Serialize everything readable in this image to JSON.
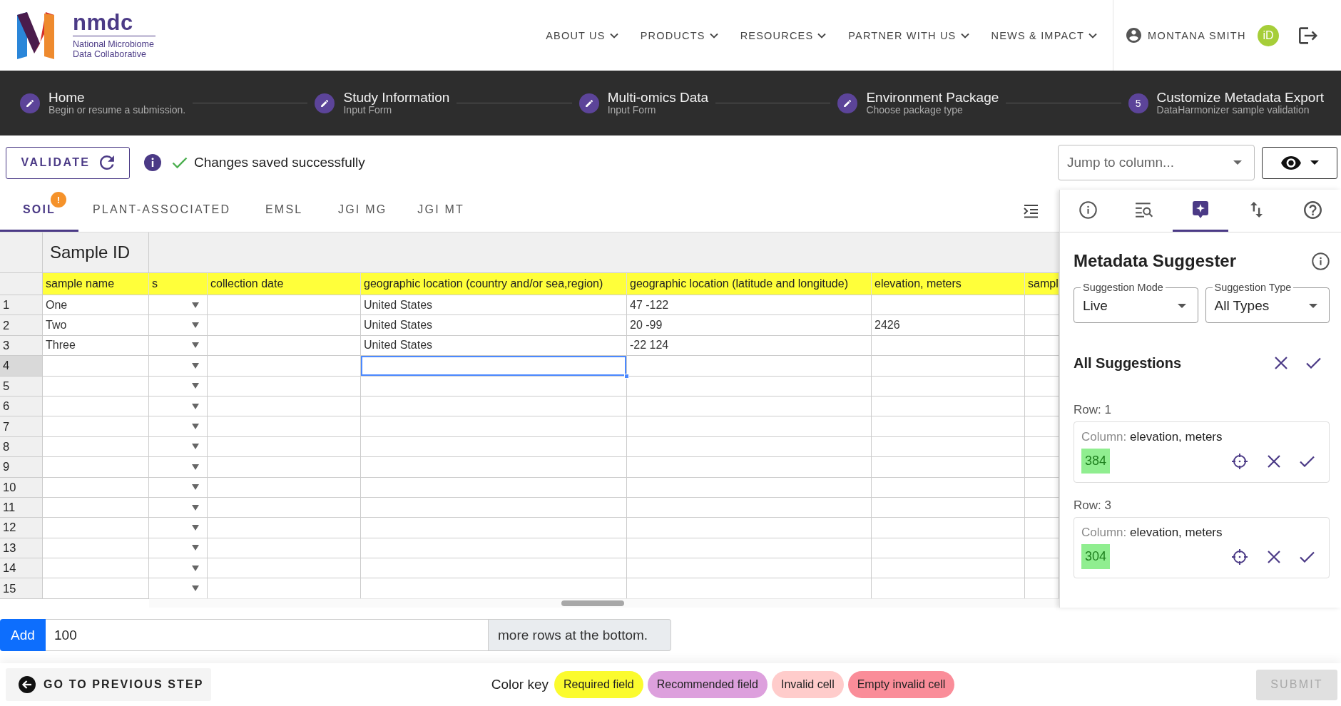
{
  "header": {
    "logo": {
      "name": "nmdc",
      "tagline": [
        "National Microbiome",
        "Data Collaborative"
      ]
    },
    "nav": [
      {
        "label": "ABOUT US"
      },
      {
        "label": "PRODUCTS"
      },
      {
        "label": "RESOURCES"
      },
      {
        "label": "PARTNER WITH US"
      },
      {
        "label": "NEWS & IMPACT"
      }
    ],
    "user": {
      "name": "MONTANA SMITH",
      "badge": "iD"
    }
  },
  "steps": [
    {
      "title": "Home",
      "subtitle": "Begin or resume a submission.",
      "complete": true
    },
    {
      "title": "Study Information",
      "subtitle": "Input Form",
      "complete": true
    },
    {
      "title": "Multi-omics Data",
      "subtitle": "Input Form",
      "complete": true
    },
    {
      "title": "Environment Package",
      "subtitle": "Choose package type",
      "complete": true
    },
    {
      "title": "Customize Metadata Export",
      "subtitle": "DataHarmonizer sample validation",
      "complete": false,
      "number": "5"
    }
  ],
  "toolbar": {
    "validate": "VALIDATE",
    "status": "Changes saved successfully",
    "jump": {
      "placeholder": "Jump to column..."
    }
  },
  "tabs": [
    {
      "label": "SOIL",
      "selected": true,
      "badge": "!"
    },
    {
      "label": "PLANT-ASSOCIATED",
      "selected": false
    },
    {
      "label": "EMSL",
      "selected": false
    },
    {
      "label": "JGI MG",
      "selected": false
    },
    {
      "label": "JGI MT",
      "selected": false
    }
  ],
  "table": {
    "group_header": "Sample ID",
    "columns": [
      {
        "label": "sample name",
        "kind": "text"
      },
      {
        "label": "s",
        "kind": "dropdown"
      },
      {
        "label": "collection date",
        "kind": "text"
      },
      {
        "label": "geographic location (country and/or sea,region)",
        "kind": "text"
      },
      {
        "label": "geographic location (latitude and longitude)",
        "kind": "text"
      },
      {
        "label": "elevation, meters",
        "kind": "text"
      },
      {
        "label": "sampl",
        "kind": "text"
      }
    ],
    "rows": [
      {
        "number": "1",
        "selected": false,
        "cells": [
          {
            "text": "One",
            "selected": false
          },
          {
            "selected": false
          },
          {
            "selected": false
          },
          {
            "text": "United States",
            "selected": false
          },
          {
            "text": "47 -122",
            "selected": false
          },
          {
            "selected": false
          },
          {
            "selected": false
          }
        ]
      },
      {
        "number": "2",
        "selected": false,
        "cells": [
          {
            "text": "Two",
            "selected": false
          },
          {
            "selected": false
          },
          {
            "selected": false
          },
          {
            "text": "United States",
            "selected": false
          },
          {
            "text": "20 -99",
            "selected": false
          },
          {
            "text": "2426",
            "selected": false
          },
          {
            "selected": false
          }
        ]
      },
      {
        "number": "3",
        "selected": false,
        "cells": [
          {
            "text": "Three",
            "selected": false
          },
          {
            "selected": false
          },
          {
            "selected": false
          },
          {
            "text": "United States",
            "selected": false
          },
          {
            "text": "-22 124",
            "selected": false
          },
          {
            "selected": false
          },
          {
            "selected": false
          }
        ]
      },
      {
        "number": "4",
        "selected": true,
        "cells": [
          {
            "selected": false
          },
          {
            "selected": false
          },
          {
            "selected": false
          },
          {
            "selected": true
          },
          {
            "selected": false
          },
          {
            "selected": false
          },
          {
            "selected": false
          }
        ]
      },
      {
        "number": "5",
        "selected": false,
        "cells": [
          {
            "selected": false
          },
          {
            "selected": false
          },
          {
            "selected": false
          },
          {
            "selected": false
          },
          {
            "selected": false
          },
          {
            "selected": false
          },
          {
            "selected": false
          }
        ]
      },
      {
        "number": "6",
        "selected": false,
        "cells": [
          {
            "selected": false
          },
          {
            "selected": false
          },
          {
            "selected": false
          },
          {
            "selected": false
          },
          {
            "selected": false
          },
          {
            "selected": false
          },
          {
            "selected": false
          }
        ]
      },
      {
        "number": "7",
        "selected": false,
        "cells": [
          {
            "selected": false
          },
          {
            "selected": false
          },
          {
            "selected": false
          },
          {
            "selected": false
          },
          {
            "selected": false
          },
          {
            "selected": false
          },
          {
            "selected": false
          }
        ]
      },
      {
        "number": "8",
        "selected": false,
        "cells": [
          {
            "selected": false
          },
          {
            "selected": false
          },
          {
            "selected": false
          },
          {
            "selected": false
          },
          {
            "selected": false
          },
          {
            "selected": false
          },
          {
            "selected": false
          }
        ]
      },
      {
        "number": "9",
        "selected": false,
        "cells": [
          {
            "selected": false
          },
          {
            "selected": false
          },
          {
            "selected": false
          },
          {
            "selected": false
          },
          {
            "selected": false
          },
          {
            "selected": false
          },
          {
            "selected": false
          }
        ]
      },
      {
        "number": "10",
        "selected": false,
        "cells": [
          {
            "selected": false
          },
          {
            "selected": false
          },
          {
            "selected": false
          },
          {
            "selected": false
          },
          {
            "selected": false
          },
          {
            "selected": false
          },
          {
            "selected": false
          }
        ]
      },
      {
        "number": "11",
        "selected": false,
        "cells": [
          {
            "selected": false
          },
          {
            "selected": false
          },
          {
            "selected": false
          },
          {
            "selected": false
          },
          {
            "selected": false
          },
          {
            "selected": false
          },
          {
            "selected": false
          }
        ]
      },
      {
        "number": "12",
        "selected": false,
        "cells": [
          {
            "selected": false
          },
          {
            "selected": false
          },
          {
            "selected": false
          },
          {
            "selected": false
          },
          {
            "selected": false
          },
          {
            "selected": false
          },
          {
            "selected": false
          }
        ]
      },
      {
        "number": "13",
        "selected": false,
        "cells": [
          {
            "selected": false
          },
          {
            "selected": false
          },
          {
            "selected": false
          },
          {
            "selected": false
          },
          {
            "selected": false
          },
          {
            "selected": false
          },
          {
            "selected": false
          }
        ]
      },
      {
        "number": "14",
        "selected": false,
        "cells": [
          {
            "selected": false
          },
          {
            "selected": false
          },
          {
            "selected": false
          },
          {
            "selected": false
          },
          {
            "selected": false
          },
          {
            "selected": false
          },
          {
            "selected": false
          }
        ]
      },
      {
        "number": "15",
        "selected": false,
        "cells": [
          {
            "selected": false
          },
          {
            "selected": false
          },
          {
            "selected": false
          },
          {
            "selected": false
          },
          {
            "selected": false
          },
          {
            "selected": false
          },
          {
            "selected": false
          }
        ]
      }
    ]
  },
  "add_rows": {
    "button": "Add",
    "value": "100",
    "suffix": "more rows at the bottom."
  },
  "panel": {
    "tabs": [
      {
        "kind": "info",
        "selected": false
      },
      {
        "kind": "search-list",
        "selected": false
      },
      {
        "kind": "suggest",
        "selected": true
      },
      {
        "kind": "sort",
        "selected": false
      },
      {
        "kind": "help",
        "selected": false
      }
    ],
    "title": "Metadata Suggester",
    "mode": {
      "label": "Suggestion Mode",
      "value": "Live"
    },
    "type": {
      "label": "Suggestion Type",
      "value": "All Types"
    },
    "all_label": "All Suggestions",
    "suggestions": [
      {
        "row": "Row: 1",
        "column_label": "Column:",
        "column": "elevation, meters",
        "value": "384"
      },
      {
        "row": "Row: 3",
        "column_label": "Column:",
        "column": "elevation, meters",
        "value": "304"
      }
    ]
  },
  "footer": {
    "back": "GO TO PREVIOUS STEP",
    "color_key": {
      "label": "Color key",
      "items": [
        {
          "label": "Required field",
          "color": "#fbfb2e"
        },
        {
          "label": "Recommended field",
          "color": "#dda0dd"
        },
        {
          "label": "Invalid cell",
          "color": "#ffcccb"
        },
        {
          "label": "Empty invalid cell",
          "color": "#fa8d99"
        }
      ]
    },
    "submit": {
      "label": "SUBMIT",
      "disabled": true
    }
  }
}
